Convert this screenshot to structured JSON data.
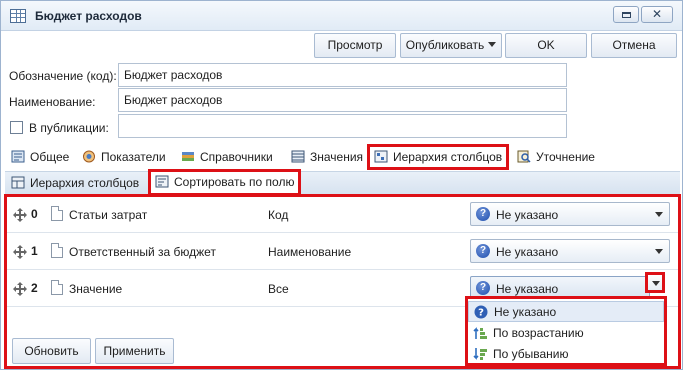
{
  "window": {
    "title": "Бюджет расходов",
    "icon": "table-icon",
    "close_symbol": "✕"
  },
  "toolbar": {
    "preview_label": "Просмотр",
    "publish_label": "Опубликовать",
    "ok_label": "OK",
    "cancel_label": "Отмена"
  },
  "form": {
    "code_label": "Обозначение (код):",
    "code_value": "Бюджет расходов",
    "name_label": "Наименование:",
    "name_value": "Бюджет расходов",
    "publication_label": "В публикации:",
    "publication_value": ""
  },
  "tabs": [
    {
      "label": "Общее",
      "icon": "general-icon"
    },
    {
      "label": "Показатели",
      "icon": "indicators-icon"
    },
    {
      "label": "Справочники",
      "icon": "dictionaries-icon"
    },
    {
      "label": "Значения",
      "icon": "values-icon"
    },
    {
      "label": "Иерархия столбцов",
      "icon": "column-hierarchy-icon",
      "highlighted": true
    },
    {
      "label": "Уточнение",
      "icon": "refinement-icon"
    }
  ],
  "subtabs": [
    {
      "label": "Иерархия столбцов",
      "icon": "column-hierarchy-icon"
    },
    {
      "label": "Сортировать по полю",
      "icon": "sort-by-field-icon",
      "highlighted": true
    }
  ],
  "rows": [
    {
      "num": "0",
      "name": "Статьи затрат",
      "column": "Код",
      "sort": "Не указано"
    },
    {
      "num": "1",
      "name": "Ответственный за бюджет",
      "column": "Наименование",
      "sort": "Не указано"
    },
    {
      "num": "2",
      "name": "Значение",
      "column": "Все",
      "sort": "Не указано"
    }
  ],
  "dropdown": {
    "options": [
      {
        "label": "Не указано",
        "icon": "question-icon",
        "selected": true
      },
      {
        "label": "По возрастанию",
        "icon": "sort-ascending-icon"
      },
      {
        "label": "По убыванию",
        "icon": "sort-descending-icon"
      }
    ]
  },
  "footer": {
    "refresh_label": "Обновить",
    "apply_label": "Применить"
  },
  "colors": {
    "highlight": "#dd1016",
    "accent": "#1f4fae"
  }
}
